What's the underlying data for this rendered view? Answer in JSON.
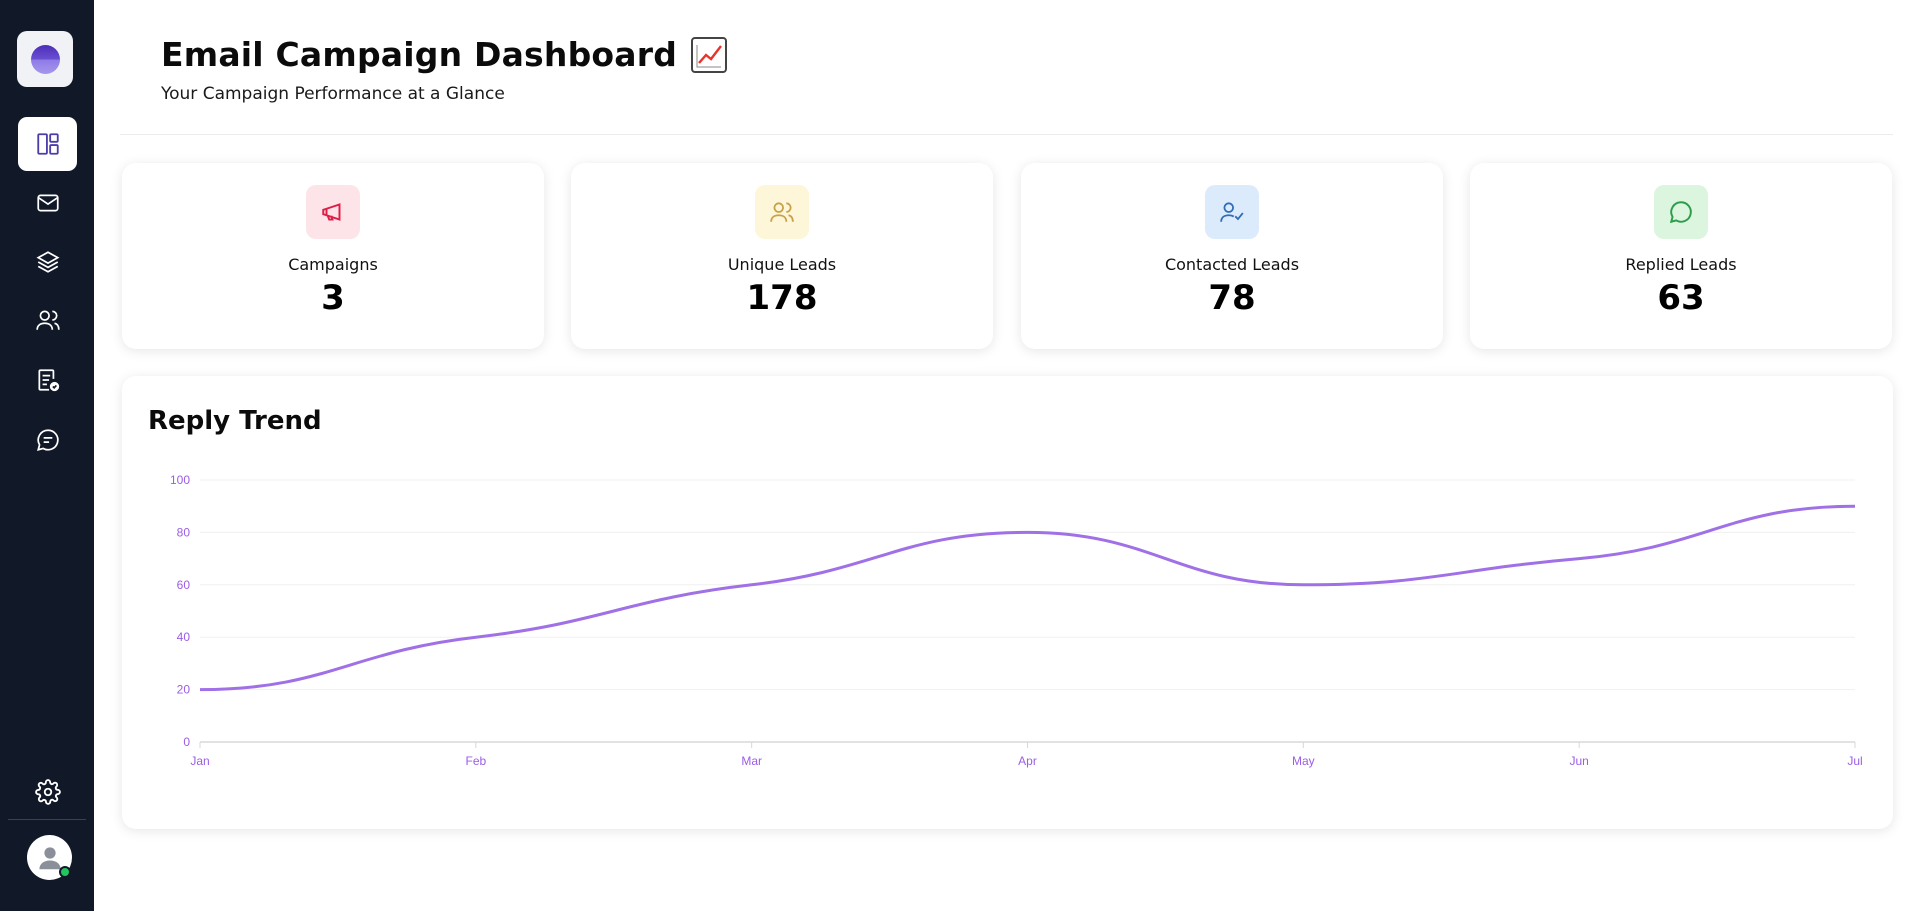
{
  "header": {
    "title": "Email Campaign Dashboard",
    "subtitle": "Your Campaign Performance at a Glance"
  },
  "sidebar": {
    "items": [
      {
        "name": "dashboard",
        "icon": "dashboard-icon",
        "active": true
      },
      {
        "name": "campaigns",
        "icon": "mail-icon",
        "active": false
      },
      {
        "name": "sequences",
        "icon": "layers-icon",
        "active": false
      },
      {
        "name": "leads",
        "icon": "users-icon",
        "active": false
      },
      {
        "name": "reports",
        "icon": "report-check-icon",
        "active": false
      },
      {
        "name": "messages",
        "icon": "chat-icon",
        "active": false
      }
    ],
    "settings_icon": "gear-icon",
    "avatar_icon": "user-avatar-icon",
    "status_color": "#22c55e"
  },
  "stats": [
    {
      "label": "Campaigns",
      "value": "3",
      "icon": "megaphone-icon",
      "icon_color": "#e11d48",
      "bg_color": "#fde4e8"
    },
    {
      "label": "Unique Leads",
      "value": "178",
      "icon": "users-icon",
      "icon_color": "#c9a14a",
      "bg_color": "#fdf6d8"
    },
    {
      "label": "Contacted Leads",
      "value": "78",
      "icon": "user-check-icon",
      "icon_color": "#2f6db5",
      "bg_color": "#dcebfb"
    },
    {
      "label": "Replied Leads",
      "value": "63",
      "icon": "chat-bubble-icon",
      "icon_color": "#2e9d4a",
      "bg_color": "#dcf5df"
    }
  ],
  "chart": {
    "title": "Reply Trend"
  },
  "chart_data": {
    "type": "line",
    "title": "Reply Trend",
    "categories": [
      "Jan",
      "Feb",
      "Mar",
      "Apr",
      "May",
      "Jun",
      "Jul"
    ],
    "series": [
      {
        "values": [
          20,
          40,
          60,
          80,
          60,
          70,
          90
        ]
      }
    ],
    "ylim": [
      0,
      100
    ],
    "yticks": [
      "0",
      "20",
      "40",
      "60",
      "80",
      "100"
    ],
    "xlabel": "",
    "ylabel": "",
    "grid": true,
    "line_color": "#a070e6",
    "tick_color": "#9b5de5"
  }
}
